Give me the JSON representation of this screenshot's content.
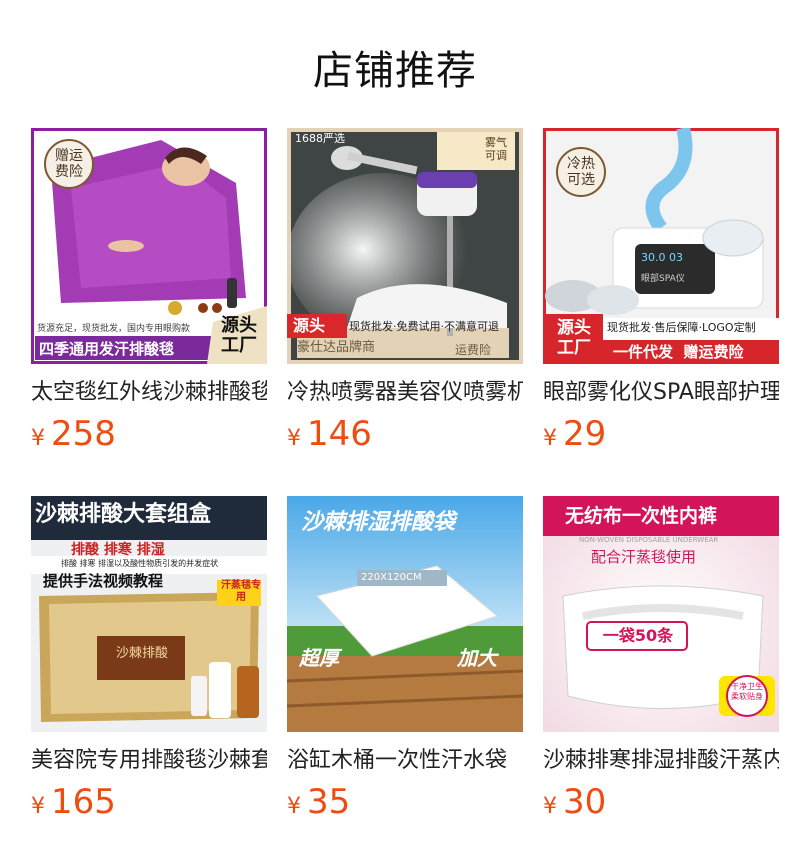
{
  "shop": {
    "title": "店铺推荐"
  },
  "colors": {
    "price": "#ee4d12",
    "title": "#111111"
  },
  "products": [
    {
      "name": "太空毯红外线沙棘排酸毯",
      "currency": "¥",
      "price": "258",
      "overlay": {
        "badge": "赠运费险",
        "strip": "货源充足，现货批发，国内专用眼购款",
        "banner": "四季通用发汗排酸毯",
        "factory": "源头工厂"
      }
    },
    {
      "name": "冷热喷雾器美容仪喷雾机",
      "currency": "¥",
      "price": "146",
      "overlay": {
        "corner": "1688严选",
        "badge": "雾气可调",
        "strip": "现货批发·免费试用·不满意可退",
        "shop": "豪仕达品牌商",
        "insurance": "运费险",
        "factory": "源头"
      }
    },
    {
      "name": "眼部雾化仪SPA眼部护理仪",
      "currency": "¥",
      "price": "29",
      "overlay": {
        "badge": "冷热可选",
        "display": "30.0 03",
        "brand": "眼部SPA仪",
        "strip": "现货批发·售后保障·LOGO定制",
        "banner": "一件代发  赠运费险",
        "factory": "源头工厂"
      }
    },
    {
      "name": "美容院专用排酸毯沙棘套装",
      "currency": "¥",
      "price": "165",
      "overlay": {
        "headline": "沙棘排酸大套组盒",
        "sub": "排酸  排寒  排湿",
        "tiny": "排酸 排寒 排湿以及酸性物质引发的并发症状",
        "cta": "提供手法视频教程",
        "tag": "汗蒸毯专用",
        "box": "沙棘排酸"
      }
    },
    {
      "name": "浴缸木桶一次性汗水袋",
      "currency": "¥",
      "price": "35",
      "overlay": {
        "headline": "沙棘排湿排酸袋",
        "size": "220X120CM",
        "left": "超厚",
        "right": "加大"
      }
    },
    {
      "name": "沙棘排寒排湿排酸汗蒸内裤",
      "currency": "¥",
      "price": "30",
      "overlay": {
        "headline": "无纺布一次性内裤",
        "english": "NON-WOVEN DISPOSABLE UNDERWEAR",
        "sub": "配合汗蒸毯使用",
        "pack": "一袋50条",
        "badge": "干净卫生 柔软贴身"
      }
    }
  ]
}
